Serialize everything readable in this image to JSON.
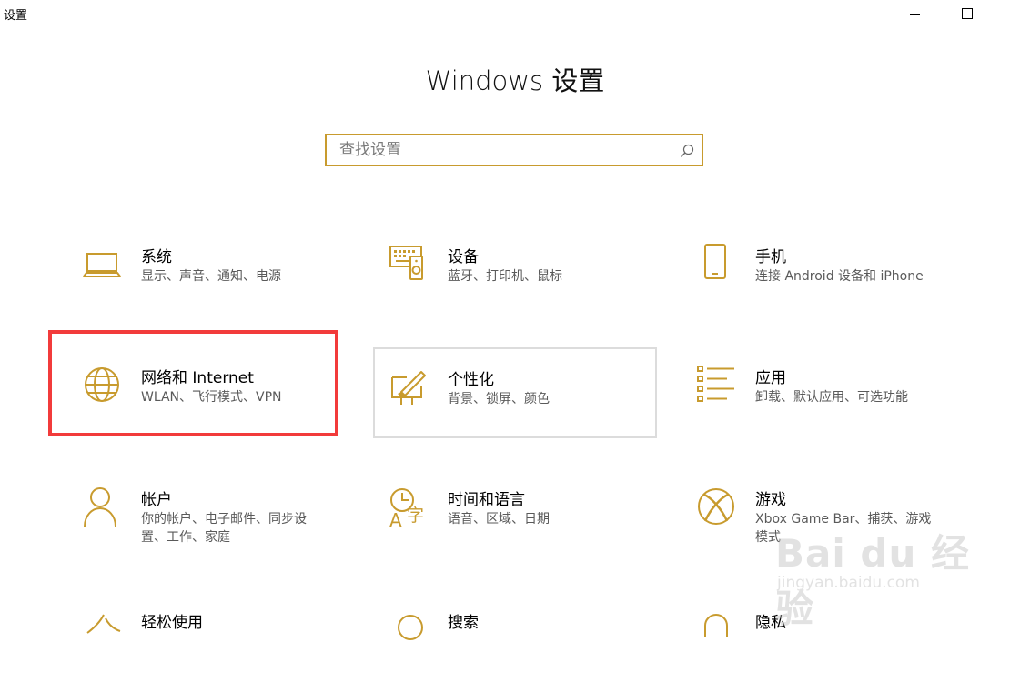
{
  "app": {
    "title": "设置"
  },
  "page": {
    "title": "Windows 设置"
  },
  "search": {
    "placeholder": "查找设置",
    "value": ""
  },
  "colors": {
    "accent": "#c89b2e",
    "highlight_box": "#f23b3b"
  },
  "tiles": [
    {
      "title": "系统",
      "subtitle": "显示、声音、通知、电源",
      "icon": "laptop-icon"
    },
    {
      "title": "设备",
      "subtitle": "蓝牙、打印机、鼠标",
      "icon": "devices-icon"
    },
    {
      "title": "手机",
      "subtitle": "连接 Android 设备和 iPhone",
      "icon": "phone-icon"
    },
    {
      "title": "网络和 Internet",
      "subtitle": "WLAN、飞行模式、VPN",
      "icon": "globe-icon"
    },
    {
      "title": "个性化",
      "subtitle": "背景、锁屏、颜色",
      "icon": "personalization-icon"
    },
    {
      "title": "应用",
      "subtitle": "卸载、默认应用、可选功能",
      "icon": "apps-list-icon"
    },
    {
      "title": "帐户",
      "subtitle": "你的帐户、电子邮件、同步设置、工作、家庭",
      "icon": "person-icon"
    },
    {
      "title": "时间和语言",
      "subtitle": "语音、区域、日期",
      "icon": "time-language-icon"
    },
    {
      "title": "游戏",
      "subtitle": "Xbox Game Bar、捕获、游戏模式",
      "icon": "xbox-icon"
    },
    {
      "title": "轻松使用",
      "subtitle": "",
      "icon": "ease-of-access-icon"
    },
    {
      "title": "搜索",
      "subtitle": "",
      "icon": "search-category-icon"
    },
    {
      "title": "隐私",
      "subtitle": "",
      "icon": "privacy-icon"
    }
  ],
  "watermark": {
    "brand": "Bai du 经验",
    "url": "jingyan.baidu.com"
  }
}
